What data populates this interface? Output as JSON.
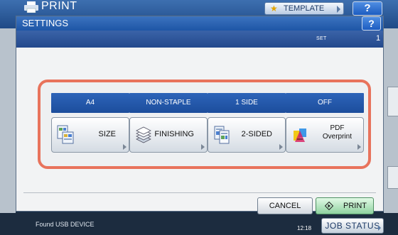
{
  "app": {
    "title": "PRINT",
    "template_label": "TEMPLATE",
    "help_label": "?"
  },
  "dialog": {
    "title": "SETTINGS",
    "help_label": "?",
    "set_label": "SET",
    "set_value": "1"
  },
  "settings": [
    {
      "value": "A4",
      "label": "SIZE",
      "icon": "paper-size-icon"
    },
    {
      "value": "NON-STAPLE",
      "label": "FINISHING",
      "icon": "finishing-icon"
    },
    {
      "value": "1 SIDE",
      "label": "2-SIDED",
      "icon": "duplex-icon"
    },
    {
      "value": "OFF",
      "label_line1": "PDF",
      "label_line2": "Overprint",
      "icon": "pdf-overprint-icon"
    }
  ],
  "actions": {
    "cancel_label": "CANCEL",
    "print_label": "PRINT"
  },
  "status": {
    "message": "Found USB DEVICE",
    "time": "12:18",
    "job_status_label": "JOB STATUS"
  },
  "colors": {
    "highlight_frame": "#e8735c",
    "value_bar": "#1f52a3",
    "print_button": "#a9dfb6"
  }
}
